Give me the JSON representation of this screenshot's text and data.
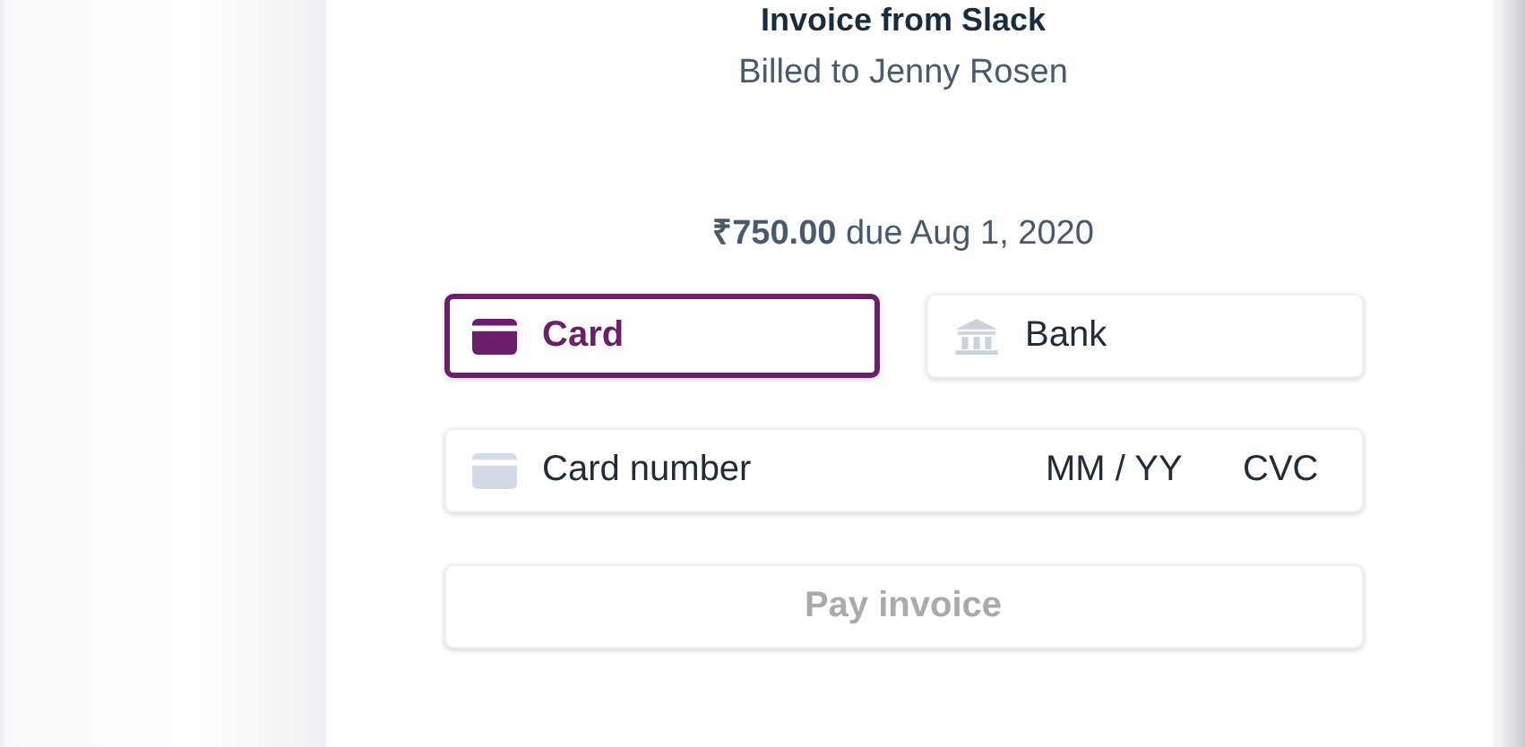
{
  "header": {
    "title": "Invoice from Slack",
    "subtitle": "Billed to Jenny Rosen"
  },
  "amount": "**₹750.00** due Aug 1, 2020",
  "payment_methods": [
    {
      "kind": "card",
      "label": "Card",
      "selected": true
    },
    {
      "kind": "bank",
      "label": "Bank",
      "selected": false
    }
  ],
  "card_field": {
    "number_placeholder": "Card number",
    "expiry_placeholder": "MM / YY",
    "cvc_placeholder": "CVC"
  },
  "pay_button": {
    "label": "Pay invoice",
    "disabled": true
  }
}
